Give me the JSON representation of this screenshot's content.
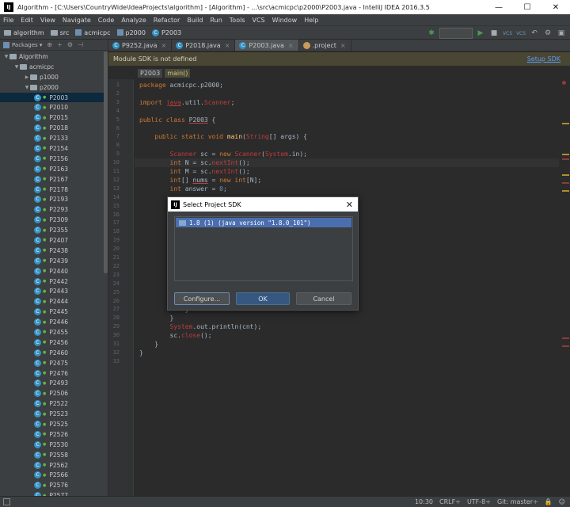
{
  "window": {
    "title": "Algorithm - [C:\\Users\\CountryWide\\IdeaProjects\\algorithm] - [Algorithm] - ...\\src\\acmicpc\\p2000\\P2003.java - IntelliJ IDEA 2016.3.5",
    "app_icon": "IJ",
    "minimize": "—",
    "maximize": "☐",
    "close": "✕"
  },
  "menu": [
    "File",
    "Edit",
    "View",
    "Navigate",
    "Code",
    "Analyze",
    "Refactor",
    "Build",
    "Run",
    "Tools",
    "VCS",
    "Window",
    "Help"
  ],
  "breadcrumb": [
    "algorithm",
    "src",
    "acmicpc",
    "p2000",
    "P2003"
  ],
  "toolbar": {
    "run_icon": "▶",
    "debug_icon": "✱",
    "stop_icon": "■",
    "vcs1": "VCS",
    "vcs2": "VCS",
    "settings_icon": "⚙",
    "undo_icon": "↶",
    "save_icon": "▣"
  },
  "project": {
    "view_selector": "Packages",
    "tree": [
      {
        "label": "Algorithm",
        "level": 0,
        "type": "module",
        "expanded": true
      },
      {
        "label": "acmicpc",
        "level": 1,
        "type": "package",
        "expanded": true
      },
      {
        "label": "p1000",
        "level": 2,
        "type": "package",
        "expanded": false
      },
      {
        "label": "p2000",
        "level": 2,
        "type": "package",
        "expanded": true
      },
      {
        "label": "P2003",
        "level": 3,
        "type": "class",
        "selected": true
      },
      {
        "label": "P2010",
        "level": 3,
        "type": "class"
      },
      {
        "label": "P2015",
        "level": 3,
        "type": "class"
      },
      {
        "label": "P2018",
        "level": 3,
        "type": "class"
      },
      {
        "label": "P2133",
        "level": 3,
        "type": "class"
      },
      {
        "label": "P2154",
        "level": 3,
        "type": "class"
      },
      {
        "label": "P2156",
        "level": 3,
        "type": "class"
      },
      {
        "label": "P2163",
        "level": 3,
        "type": "class"
      },
      {
        "label": "P2167",
        "level": 3,
        "type": "class"
      },
      {
        "label": "P2178",
        "level": 3,
        "type": "class"
      },
      {
        "label": "P2193",
        "level": 3,
        "type": "class"
      },
      {
        "label": "P2293",
        "level": 3,
        "type": "class"
      },
      {
        "label": "P2309",
        "level": 3,
        "type": "class"
      },
      {
        "label": "P2355",
        "level": 3,
        "type": "class"
      },
      {
        "label": "P2407",
        "level": 3,
        "type": "class"
      },
      {
        "label": "P2438",
        "level": 3,
        "type": "class"
      },
      {
        "label": "P2439",
        "level": 3,
        "type": "class"
      },
      {
        "label": "P2440",
        "level": 3,
        "type": "class"
      },
      {
        "label": "P2442",
        "level": 3,
        "type": "class"
      },
      {
        "label": "P2443",
        "level": 3,
        "type": "class"
      },
      {
        "label": "P2444",
        "level": 3,
        "type": "class"
      },
      {
        "label": "P2445",
        "level": 3,
        "type": "class"
      },
      {
        "label": "P2446",
        "level": 3,
        "type": "class"
      },
      {
        "label": "P2455",
        "level": 3,
        "type": "class"
      },
      {
        "label": "P2456",
        "level": 3,
        "type": "class"
      },
      {
        "label": "P2460",
        "level": 3,
        "type": "class"
      },
      {
        "label": "P2475",
        "level": 3,
        "type": "class"
      },
      {
        "label": "P2476",
        "level": 3,
        "type": "class"
      },
      {
        "label": "P2493",
        "level": 3,
        "type": "class"
      },
      {
        "label": "P2506",
        "level": 3,
        "type": "class"
      },
      {
        "label": "P2522",
        "level": 3,
        "type": "class"
      },
      {
        "label": "P2523",
        "level": 3,
        "type": "class"
      },
      {
        "label": "P2525",
        "level": 3,
        "type": "class"
      },
      {
        "label": "P2526",
        "level": 3,
        "type": "class"
      },
      {
        "label": "P2530",
        "level": 3,
        "type": "class"
      },
      {
        "label": "P2558",
        "level": 3,
        "type": "class"
      },
      {
        "label": "P2562",
        "level": 3,
        "type": "class"
      },
      {
        "label": "P2566",
        "level": 3,
        "type": "class"
      },
      {
        "label": "P2576",
        "level": 3,
        "type": "class"
      },
      {
        "label": "P2577",
        "level": 3,
        "type": "class"
      }
    ]
  },
  "tabs": [
    {
      "label": "P9252.java",
      "type": "class",
      "active": false
    },
    {
      "label": "P2018.java",
      "type": "class",
      "active": false
    },
    {
      "label": "P2003.java",
      "type": "class",
      "active": true
    },
    {
      "label": ".project",
      "type": "project",
      "active": false
    }
  ],
  "sdk_warning": {
    "message": "Module SDK is not defined",
    "action": "Setup SDK"
  },
  "code_crumbs": {
    "class_name": "P2003",
    "method": "main()"
  },
  "editor": {
    "current_line": 10,
    "lines": [
      {
        "n": 1,
        "html": "<span class=\"kw\">package</span> acmicpc.p2000;"
      },
      {
        "n": 2,
        "html": ""
      },
      {
        "n": 3,
        "html": "<span class=\"kw\">import</span> <span class=\"err ul\">java</span>.util.<span class=\"err\">Scanner</span>;"
      },
      {
        "n": 4,
        "html": ""
      },
      {
        "n": 5,
        "html": "<span class=\"kw\">public class</span> <span class=\"ul\">P2003</span> {"
      },
      {
        "n": 6,
        "html": ""
      },
      {
        "n": 7,
        "html": "    <span class=\"kw\">public static void</span> <span class=\"fn\">main</span>(<span class=\"err\">String</span>[] args) {"
      },
      {
        "n": 8,
        "html": ""
      },
      {
        "n": 9,
        "html": "        <span class=\"err\">Scanner</span> sc = <span class=\"kw\">new</span> <span class=\"err\">Scanner</span>(<span class=\"err\">System</span>.in);"
      },
      {
        "n": 10,
        "html": "        <span class=\"kw\">int</span> N = sc.<span class=\"err\">nextInt</span>();"
      },
      {
        "n": 11,
        "html": "        <span class=\"kw\">int</span> M = sc.<span class=\"err\">nextInt</span>();"
      },
      {
        "n": 12,
        "html": "        <span class=\"kw\">int</span>[] <span class=\"ul\">nums</span> = <span class=\"kw\">new int</span>[N];"
      },
      {
        "n": 13,
        "html": "        <span class=\"kw\">int</span> answer = <span class=\"num\">0</span>;"
      },
      {
        "n": 14,
        "html": ""
      },
      {
        "n": 15,
        "html": ""
      },
      {
        "n": 16,
        "html": ""
      },
      {
        "n": 17,
        "html": ""
      },
      {
        "n": 18,
        "html": ""
      },
      {
        "n": 19,
        "html": ""
      },
      {
        "n": 20,
        "html": ""
      },
      {
        "n": 21,
        "html": ""
      },
      {
        "n": 22,
        "html": ""
      },
      {
        "n": 23,
        "html": ""
      },
      {
        "n": 24,
        "html": ""
      },
      {
        "n": 25,
        "html": ""
      },
      {
        "n": 26,
        "html": ""
      },
      {
        "n": 27,
        "html": "            }"
      },
      {
        "n": 28,
        "html": "        }"
      },
      {
        "n": 29,
        "html": "        <span class=\"err\">System</span>.out.println(cnt);"
      },
      {
        "n": 30,
        "html": "        sc.<span class=\"err\">close</span>();"
      },
      {
        "n": 31,
        "html": "    }"
      },
      {
        "n": 32,
        "html": "}"
      },
      {
        "n": 33,
        "html": ""
      }
    ]
  },
  "dialog": {
    "title": "Select Project SDK",
    "close_icon": "✕",
    "sdk_item": "1.8 (1) (java version \"1.8.0_101\")",
    "configure_label": "Configure...",
    "ok_label": "OK",
    "cancel_label": "Cancel"
  },
  "statusbar": {
    "position": "10:30",
    "line_separator": "CRLF÷",
    "encoding": "UTF-8÷",
    "git": "Git: master÷",
    "lock_icon": "🔒",
    "inspector_icon": "☺"
  }
}
